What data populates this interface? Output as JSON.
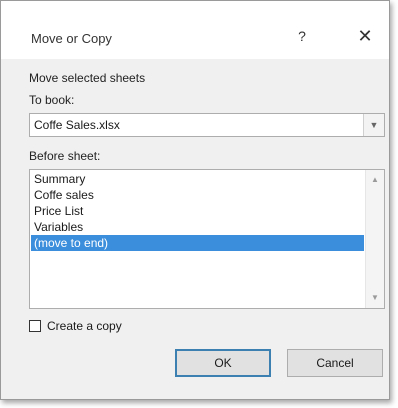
{
  "dialog": {
    "title": "Move or Copy",
    "help_glyph": "?",
    "close_glyph": "✕"
  },
  "move_label": "Move selected sheets",
  "to_book": {
    "label": "To book:",
    "selected": "Coffe Sales.xlsx",
    "arrow_glyph": "▼"
  },
  "before_sheet": {
    "label": "Before sheet:",
    "items": [
      "Summary",
      "Coffe sales",
      "Price List",
      "Variables",
      "(move to end)"
    ],
    "selected_index": 4,
    "scroll_up_glyph": "▲",
    "scroll_down_glyph": "▼"
  },
  "create_copy": {
    "label": "Create a copy",
    "checked": false
  },
  "buttons": {
    "ok": "OK",
    "cancel": "Cancel"
  }
}
